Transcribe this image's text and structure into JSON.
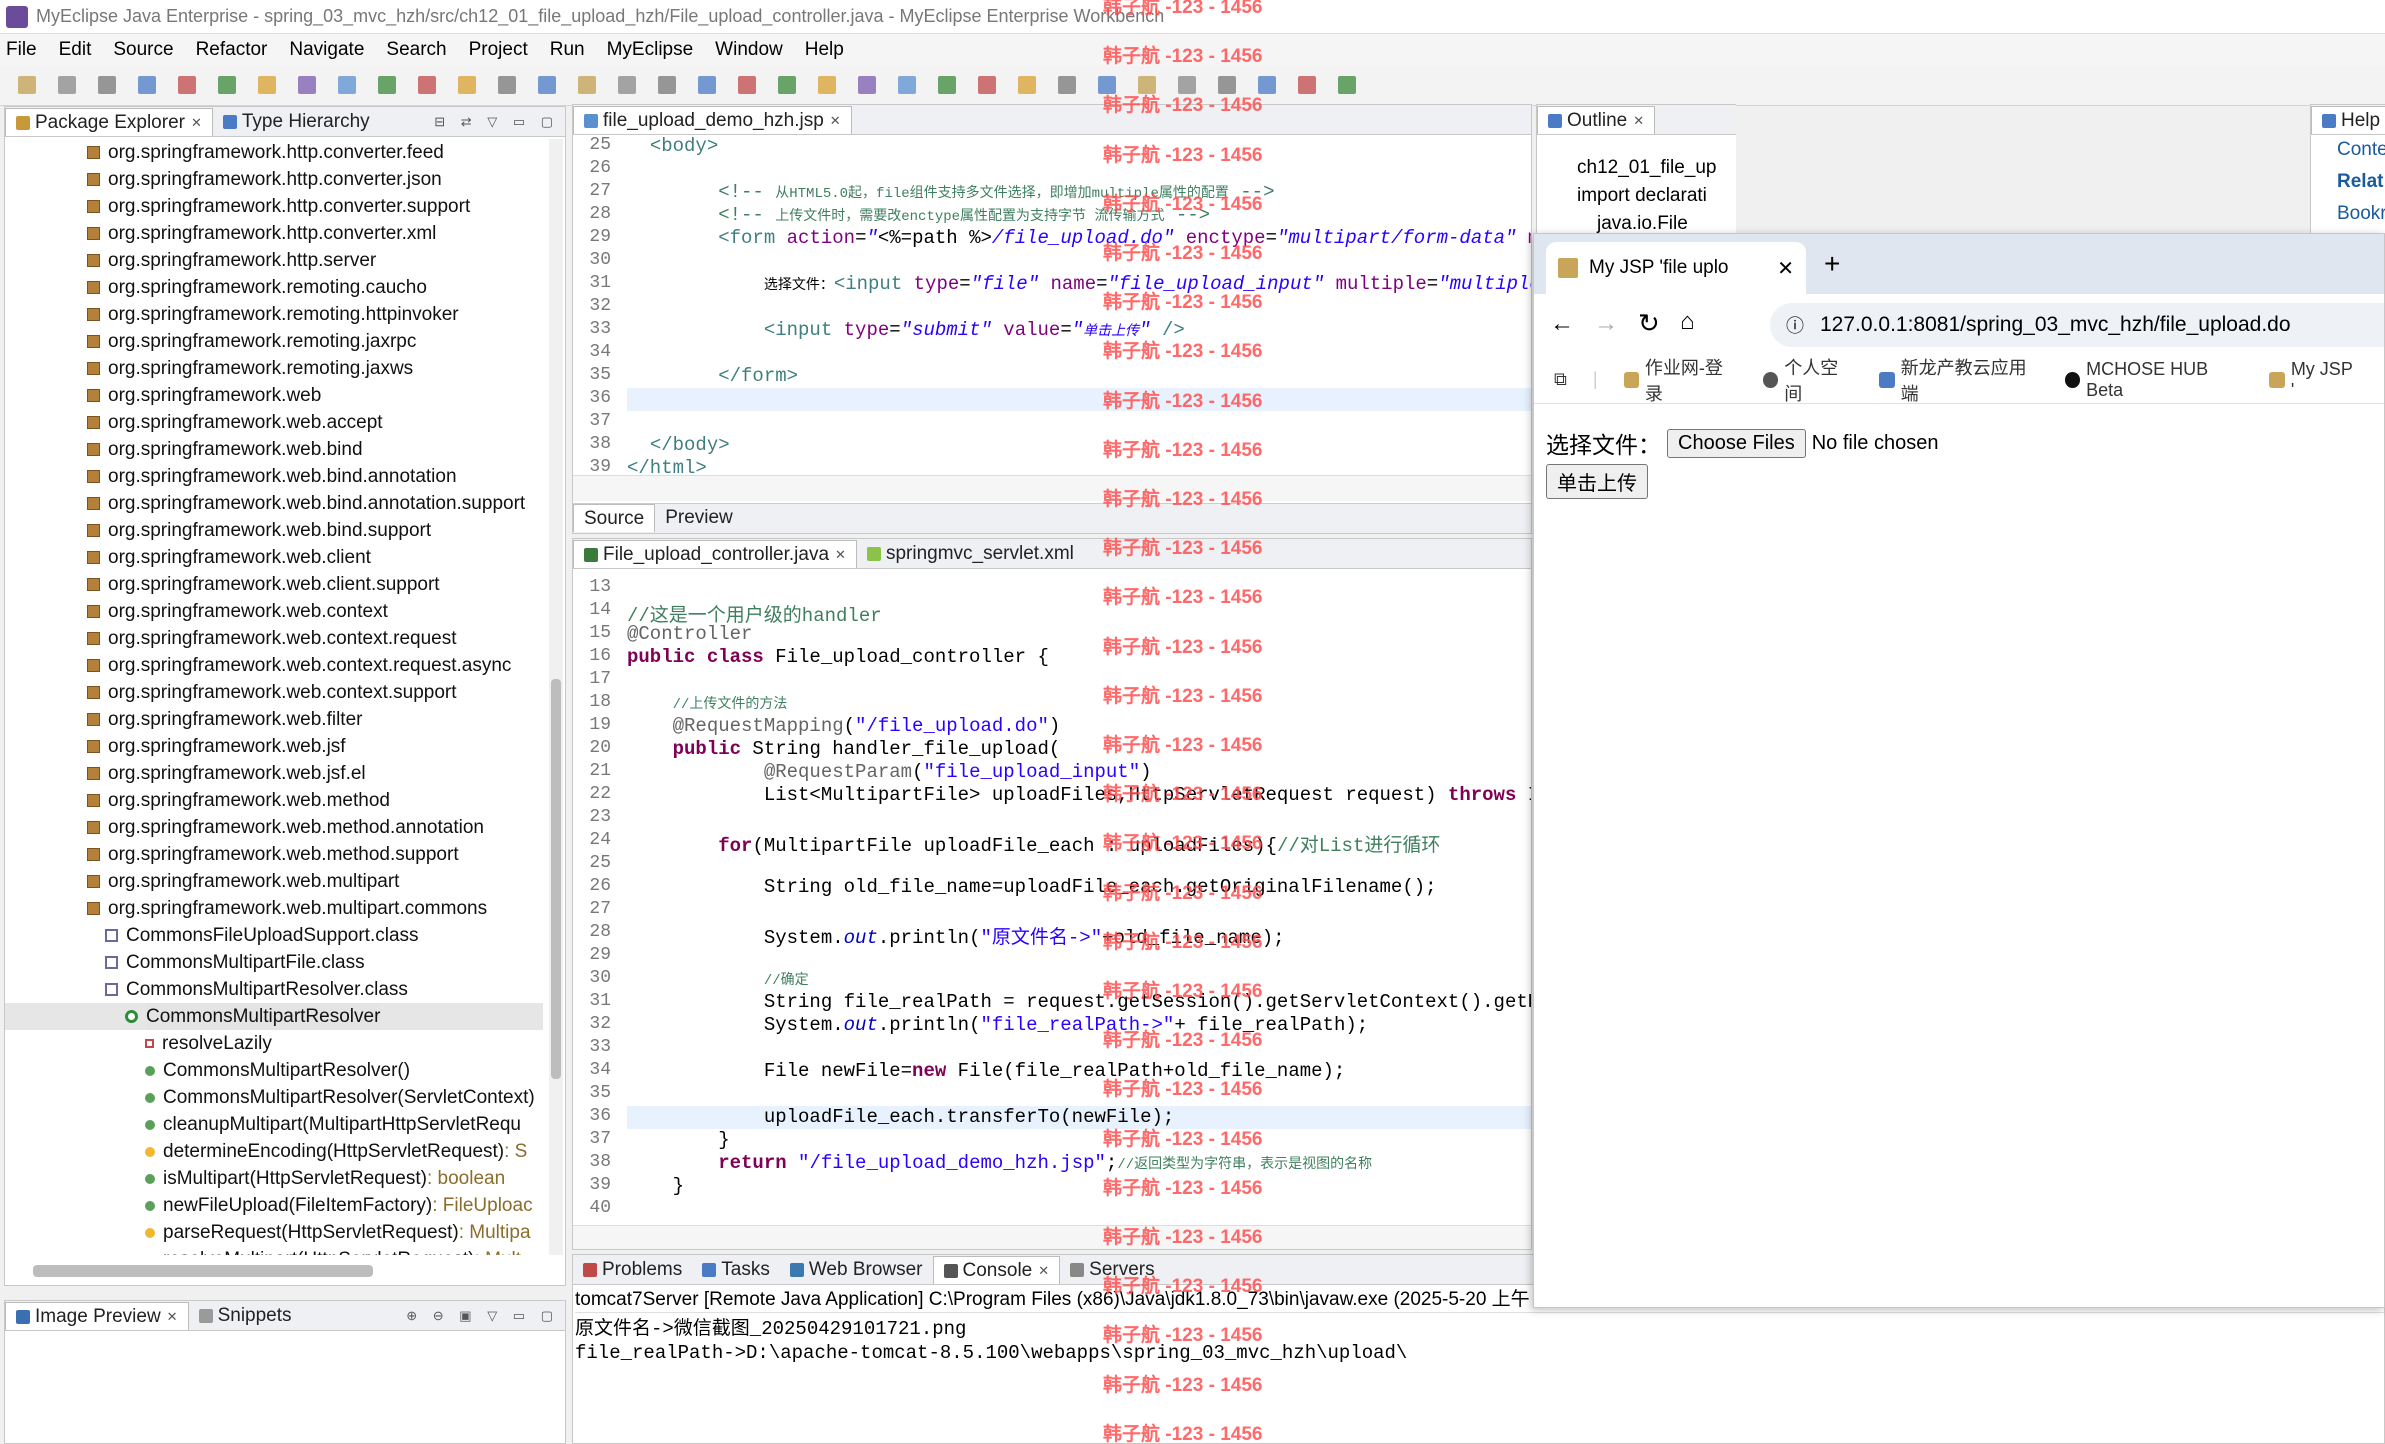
{
  "window": {
    "title": "MyEclipse Java Enterprise - spring_03_mvc_hzh/src/ch12_01_file_upload_hzh/File_upload_controller.java - MyEclipse Enterprise Workbench"
  },
  "menu": [
    "File",
    "Edit",
    "Source",
    "Refactor",
    "Navigate",
    "Search",
    "Project",
    "Run",
    "MyEclipse",
    "Window",
    "Help"
  ],
  "left_panel": {
    "tabs": [
      "Package Explorer",
      "Type Hierarchy"
    ],
    "items": [
      {
        "t": "org.springframework.http.converter.feed",
        "k": "pkg",
        "d": 0
      },
      {
        "t": "org.springframework.http.converter.json",
        "k": "pkg",
        "d": 0
      },
      {
        "t": "org.springframework.http.converter.support",
        "k": "pkg",
        "d": 0
      },
      {
        "t": "org.springframework.http.converter.xml",
        "k": "pkg",
        "d": 0
      },
      {
        "t": "org.springframework.http.server",
        "k": "pkg",
        "d": 0
      },
      {
        "t": "org.springframework.remoting.caucho",
        "k": "pkg",
        "d": 0
      },
      {
        "t": "org.springframework.remoting.httpinvoker",
        "k": "pkg",
        "d": 0
      },
      {
        "t": "org.springframework.remoting.jaxrpc",
        "k": "pkg",
        "d": 0
      },
      {
        "t": "org.springframework.remoting.jaxws",
        "k": "pkg",
        "d": 0
      },
      {
        "t": "org.springframework.web",
        "k": "pkg",
        "d": 0
      },
      {
        "t": "org.springframework.web.accept",
        "k": "pkg",
        "d": 0
      },
      {
        "t": "org.springframework.web.bind",
        "k": "pkg",
        "d": 0
      },
      {
        "t": "org.springframework.web.bind.annotation",
        "k": "pkg",
        "d": 0
      },
      {
        "t": "org.springframework.web.bind.annotation.support",
        "k": "pkg",
        "d": 0
      },
      {
        "t": "org.springframework.web.bind.support",
        "k": "pkg",
        "d": 0
      },
      {
        "t": "org.springframework.web.client",
        "k": "pkg",
        "d": 0
      },
      {
        "t": "org.springframework.web.client.support",
        "k": "pkg",
        "d": 0
      },
      {
        "t": "org.springframework.web.context",
        "k": "pkg",
        "d": 0
      },
      {
        "t": "org.springframework.web.context.request",
        "k": "pkg",
        "d": 0
      },
      {
        "t": "org.springframework.web.context.request.async",
        "k": "pkg",
        "d": 0
      },
      {
        "t": "org.springframework.web.context.support",
        "k": "pkg",
        "d": 0
      },
      {
        "t": "org.springframework.web.filter",
        "k": "pkg",
        "d": 0
      },
      {
        "t": "org.springframework.web.jsf",
        "k": "pkg",
        "d": 0
      },
      {
        "t": "org.springframework.web.jsf.el",
        "k": "pkg",
        "d": 0
      },
      {
        "t": "org.springframework.web.method",
        "k": "pkg",
        "d": 0
      },
      {
        "t": "org.springframework.web.method.annotation",
        "k": "pkg",
        "d": 0
      },
      {
        "t": "org.springframework.web.method.support",
        "k": "pkg",
        "d": 0
      },
      {
        "t": "org.springframework.web.multipart",
        "k": "pkg",
        "d": 0
      },
      {
        "t": "org.springframework.web.multipart.commons",
        "k": "pkg",
        "d": 0
      },
      {
        "t": "CommonsFileUploadSupport.class",
        "k": "cls",
        "d": 1
      },
      {
        "t": "CommonsMultipartFile.class",
        "k": "cls",
        "d": 1
      },
      {
        "t": "CommonsMultipartResolver.class",
        "k": "cls",
        "d": 1
      },
      {
        "t": "CommonsMultipartResolver",
        "k": "c",
        "d": 2,
        "sel": true
      },
      {
        "t": "resolveLazily",
        "k": "s",
        "d": 3
      },
      {
        "t": "CommonsMultipartResolver()",
        "k": "m",
        "d": 3
      },
      {
        "t": "CommonsMultipartResolver(ServletContext)",
        "k": "m",
        "d": 3
      },
      {
        "t": "cleanupMultipart(MultipartHttpServletRequ",
        "k": "m",
        "d": 3
      },
      {
        "t": "determineEncoding(HttpServletRequest)",
        "k": "p",
        "d": 3,
        "r": " : S"
      },
      {
        "t": "isMultipart(HttpServletRequest)",
        "k": "m",
        "d": 3,
        "r": " : boolean"
      },
      {
        "t": "newFileUpload(FileItemFactory)",
        "k": "m",
        "d": 3,
        "r": " : FileUploac"
      },
      {
        "t": "parseRequest(HttpServletRequest)",
        "k": "p",
        "d": 3,
        "r": " : Multipa"
      },
      {
        "t": "resolveMultipart(HttpServletRequest)",
        "k": "m",
        "d": 3,
        "r": " : Mult"
      }
    ],
    "bottom_tabs": [
      "Image Preview",
      "Snippets"
    ]
  },
  "jsp_editor": {
    "tab": "file_upload_demo_hzh.jsp",
    "bottom_tabs": [
      "Source",
      "Preview"
    ],
    "lines": [
      {
        "n": "25",
        "h": "&nbsp;&nbsp;<span class=\"tag\">&lt;body&gt;</span>"
      },
      {
        "n": "26",
        "h": ""
      },
      {
        "n": "27",
        "h": "        <span class=\"cm\">&lt;!-- </span><span class=\"cmz\">从HTML5.0起，file组件支持多文件选择，即增加multiple属性的配置</span><span class=\"cm\"> --&gt;</span>"
      },
      {
        "n": "28",
        "h": "        <span class=\"cm\">&lt;!-- </span><span class=\"cmz\">上传文件时，需要改enctype属性配置为支持字节 流传输方式</span><span class=\"cm\"> --&gt;</span>"
      },
      {
        "n": "29",
        "h": "        <span class=\"tag\">&lt;form</span> <span class=\"attr\">action</span>=<span class=\"it\">\"</span>&lt;%=path %&gt;<span class=\"it\">/file_upload.do\"</span> <span class=\"attr\">enctype</span>=<span class=\"it\">\"multipart/form-data\"</span> <span class=\"attr\">method</span>=<span class=\"it\">\"post\"</span>&gt;"
      },
      {
        "n": "30",
        "h": ""
      },
      {
        "n": "31",
        "h": "            <span class=\"cmz\" style=\"color:#000\">选择文件：</span><span class=\"tag\">&lt;input</span> <span class=\"attr\">type</span>=<span class=\"it\">\"file\"</span> <span class=\"attr\">name</span>=<span class=\"it\">\"file_upload_input\"</span> <span class=\"attr\">multiple</span>=<span class=\"it\">\"multiple\"</span>"
      },
      {
        "n": "32",
        "h": ""
      },
      {
        "n": "33",
        "h": "            <span class=\"tag\">&lt;input</span> <span class=\"attr\">type</span>=<span class=\"it\">\"submit\"</span> <span class=\"attr\">value</span>=<span class=\"it\">\"<span style=\"font-size:14px\">单击上传</span>\"</span> <span class=\"tag\">/&gt;</span>"
      },
      {
        "n": "34",
        "h": ""
      },
      {
        "n": "35",
        "h": "        <span class=\"tag\">&lt;/form&gt;</span>"
      },
      {
        "n": "36",
        "h": ""
      },
      {
        "n": "37",
        "h": ""
      },
      {
        "n": "38",
        "h": "&nbsp;&nbsp;<span class=\"tag\">&lt;/body&gt;</span>"
      },
      {
        "n": "39",
        "h": "<span class=\"tag\">&lt;/html&gt;</span>"
      }
    ]
  },
  "java_editor": {
    "tabs": [
      "File_upload_controller.java",
      "springmvc_servlet.xml"
    ],
    "lines": [
      {
        "n": "13",
        "h": ""
      },
      {
        "n": "14",
        "h": "<span class=\"cm\">//这是一个用户级的handler</span>"
      },
      {
        "n": "15",
        "h": "<span class=\"ann\">@Controller</span>"
      },
      {
        "n": "16",
        "h": "<span class=\"kw\">public class</span> File_upload_controller {"
      },
      {
        "n": "17",
        "h": ""
      },
      {
        "n": "18",
        "h": "    <span class=\"cmz\">//上传文件的方法</span>"
      },
      {
        "n": "19",
        "h": "    <span class=\"ann\">@RequestMapping</span>(<span class=\"str\">\"/file_upload.do\"</span>)"
      },
      {
        "n": "20",
        "h": "    <span class=\"kw\">public</span> String handler_file_upload("
      },
      {
        "n": "21",
        "h": "            <span class=\"ann\">@RequestParam</span>(<span class=\"str\">\"file_upload_input\"</span>)"
      },
      {
        "n": "22",
        "h": "            List&lt;MultipartFile&gt; uploadFiles,HttpServletRequest request) <span class=\"kw\">throws</span> Ille"
      },
      {
        "n": "23",
        "h": ""
      },
      {
        "n": "24",
        "h": "        <span class=\"kw\">for</span>(MultipartFile uploadFile_each : uploadFiles){<span class=\"cm\">//对List进行循环</span>"
      },
      {
        "n": "25",
        "h": ""
      },
      {
        "n": "26",
        "h": "            String old_file_name=uploadFile_each.getOriginalFilename();"
      },
      {
        "n": "27",
        "h": ""
      },
      {
        "n": "28",
        "h": "            System.<span class=\"fld\">out</span>.println(<span class=\"str\">\"原文件名-&gt;\"</span>+old_file_name);"
      },
      {
        "n": "29",
        "h": ""
      },
      {
        "n": "30",
        "h": "            <span class=\"cmz\">//确定</span>"
      },
      {
        "n": "31",
        "h": "            String file_realPath = request.getSession().getServletContext().getReal"
      },
      {
        "n": "32",
        "h": "            System.<span class=\"fld\">out</span>.println(<span class=\"str\">\"file_realPath-&gt;\"</span>+ file_realPath);"
      },
      {
        "n": "33",
        "h": ""
      },
      {
        "n": "34",
        "h": "            File newFile=<span class=\"kw\">new</span> File(file_realPath+old_file_name);"
      },
      {
        "n": "35",
        "h": ""
      },
      {
        "n": "36",
        "h": "            uploadFile_each.transferTo(newFile);"
      },
      {
        "n": "37",
        "h": "        }"
      },
      {
        "n": "38",
        "h": "        <span class=\"kw\">return</span> <span class=\"str\">\"/file_upload_demo_hzh.jsp\"</span>;<span class=\"cmz\">//返回类型为字符串，表示是视图的名称</span>"
      },
      {
        "n": "39",
        "h": "    }"
      },
      {
        "n": "40",
        "h": ""
      }
    ]
  },
  "console": {
    "tabs": [
      "Problems",
      "Tasks",
      "Web Browser",
      "Console",
      "Servers"
    ],
    "header": "tomcat7Server [Remote Java Application] C:\\Program Files (x86)\\Java\\jdk1.8.0_73\\bin\\javaw.exe (2025-5-20 上午",
    "lines": [
      "原文件名->微信截图_20250429101721.png",
      "file_realPath->D:\\apache-tomcat-8.5.100\\webapps\\spring_03_mvc_hzh\\upload\\"
    ]
  },
  "outline": {
    "tab": "Outline",
    "items": [
      "ch12_01_file_up",
      "import declarati",
      "java.io.File"
    ]
  },
  "help": {
    "tab": "Help",
    "items": [
      "Conte",
      "Relat",
      "Bookr"
    ]
  },
  "browser": {
    "tab_title": "My JSP 'file uplo",
    "url": "127.0.0.1:8081/spring_03_mvc_hzh/file_upload.do",
    "bookmarks": [
      "作业网-登录",
      "个人空间",
      "新龙产教云应用端",
      "MCHOSE HUB Beta",
      "My JSP '"
    ],
    "label": "选择文件：",
    "choose_btn": "Choose Files",
    "no_file": "No file chosen",
    "submit": "单击上传"
  },
  "watermark": "韩子航 -123 - 1456",
  "colors": {
    "keyword": "#7f0055",
    "string": "#2a00ff",
    "comment": "#3f7f5f",
    "watermark": "#ff5050"
  }
}
